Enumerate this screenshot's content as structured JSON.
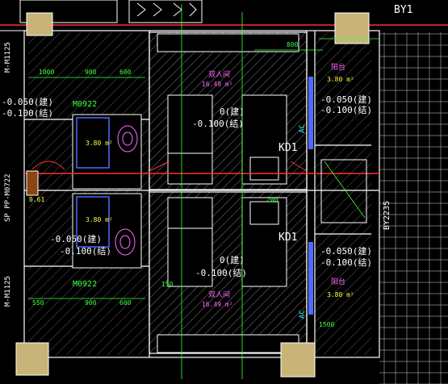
{
  "colors": {
    "background": "#000000",
    "wall_hatch": "#9a9a9a",
    "column_fill": "#c8b478",
    "dimension": "#3cff3c",
    "axis_red": "#ff3030",
    "door_blue": "#4f6bff",
    "cyan": "#3cf0ff",
    "magenta": "#ff6bff",
    "yellow": "#ffff3c",
    "white": "#ffffff"
  },
  "labels": {
    "by1": "BY1",
    "by2235": "BY2235",
    "kd1_upper": "KD1",
    "kd1_lower": "KD1",
    "m0922_upper": "M0922",
    "m0922_lower": "M0922",
    "m_side_upper": "M-M1125",
    "m_side_lower": "M-M1125",
    "sp_side": "SP PP-M0722",
    "ac_upper": "AC",
    "ac_lower": "AC"
  },
  "levels": {
    "center_upper_arch": "0(建)",
    "center_upper_struct": "-0.100(结)",
    "center_lower_arch": "0(建)",
    "center_lower_struct": "-0.100(结)",
    "left_upper_arch": "-0.050(建)",
    "left_upper_struct": "-0.100(结)",
    "left_mid_arch": "-0.050(建)",
    "left_mid_struct": "-0.100(结)",
    "right_upper_arch": "-0.050(建)",
    "right_upper_struct": "-0.100(结)",
    "right_lower_arch": "-0.050(建)",
    "right_lower_struct": "-0.100(结)"
  },
  "rooms": {
    "upper_room": "双人间",
    "upper_area": "16.49 m²",
    "lower_room": "双人间",
    "lower_area": "16.49 m²",
    "upper_bath_area": "3.80 m²",
    "lower_bath_area": "3.80 m²",
    "upper_balcony": "阳台",
    "upper_balcony_area": "3.80 m²",
    "lower_balcony": "阳台",
    "lower_balcony_area": "3.80 m²",
    "small_area": "0.61"
  },
  "dims": {
    "d1000": "1000",
    "d900": "900",
    "d600": "600",
    "d800": "800",
    "d150": "150",
    "d200": "200",
    "d1500": "1500",
    "d550": "550"
  }
}
